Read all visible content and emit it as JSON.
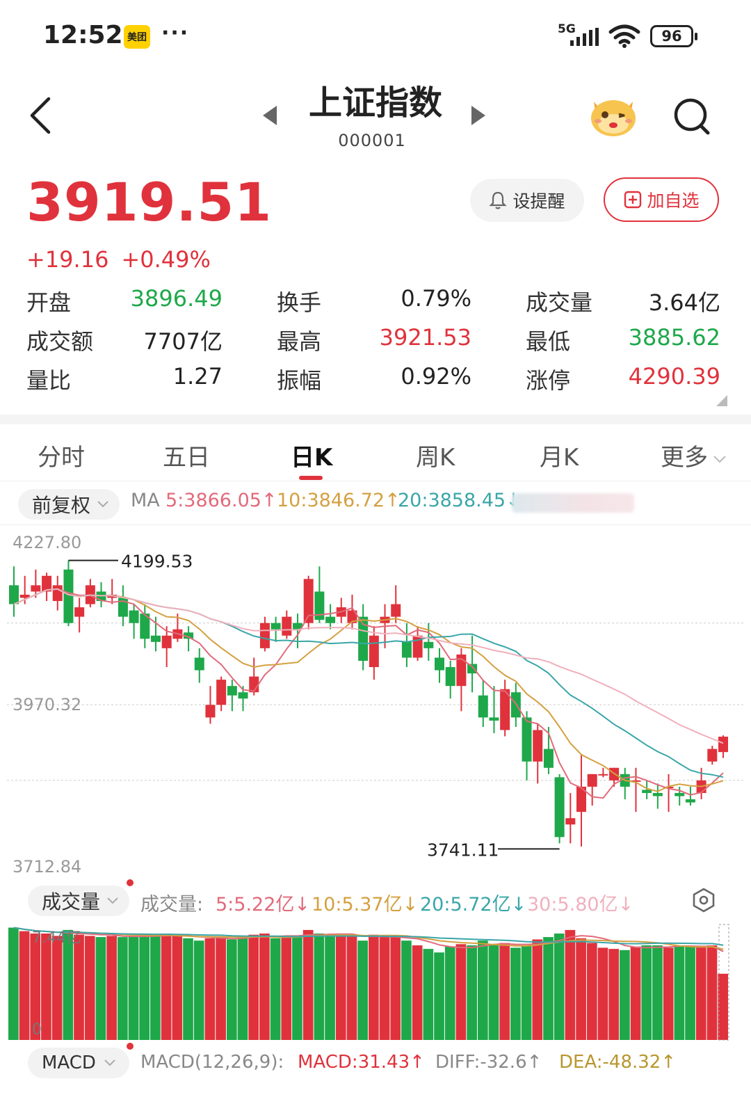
{
  "status": {
    "time": "12:52",
    "app_badge": "美团",
    "more": "···",
    "network": "5G",
    "battery": "96"
  },
  "header": {
    "title": "上证指数",
    "code": "000001"
  },
  "quote": {
    "price": "3919.51",
    "change": "+19.16",
    "change_pct": "+0.49%",
    "alert_label": "设提醒",
    "watch_label": "加自选",
    "stats": [
      {
        "label": "开盘",
        "value": "3896.49",
        "color": "green"
      },
      {
        "label": "换手",
        "value": "0.79%",
        "color": "dark"
      },
      {
        "label": "成交量",
        "value": "3.64亿",
        "color": "dark"
      },
      {
        "label": "成交额",
        "value": "7707亿",
        "color": "dark"
      },
      {
        "label": "最高",
        "value": "3921.53",
        "color": "red"
      },
      {
        "label": "最低",
        "value": "3885.62",
        "color": "green"
      },
      {
        "label": "量比",
        "value": "1.27",
        "color": "dark"
      },
      {
        "label": "振幅",
        "value": "0.92%",
        "color": "dark"
      },
      {
        "label": "涨停",
        "value": "4290.39",
        "color": "red"
      }
    ]
  },
  "tabs": [
    "分时",
    "五日",
    "日K",
    "周K",
    "月K",
    "更多"
  ],
  "ma_bar": {
    "adjust": "前复权",
    "ma_label": "MA",
    "ma5": "5:3866.05↑",
    "ma10": "10:3846.72↑",
    "ma20": "20:3858.45↓"
  },
  "volume_bar": {
    "label": "成交量",
    "title": "成交量:",
    "v5": "5:5.22亿↓",
    "v10": "10:5.37亿↓",
    "v20": "20:5.72亿↓",
    "v30": "30:5.80亿↓"
  },
  "macd_bar": {
    "label": "MACD",
    "params": "MACD(12,26,9):",
    "macd": "MACD:31.43↑",
    "diff": "DIFF:-32.6↑",
    "dea": "DEA:-48.32↑"
  },
  "colors": {
    "up": "#e0323c",
    "down": "#1ea84a",
    "ma5": "#e26a7a",
    "ma10": "#d4a040",
    "ma20": "#3aa6a8",
    "ma30": "#f0b0bc"
  },
  "chart_data": {
    "type": "candlestick",
    "y_axis_labels": [
      "4227.80",
      "3970.32",
      "3712.84"
    ],
    "ylim": [
      3712.84,
      4227.8
    ],
    "annotations": {
      "high": "4199.53",
      "low": "3741.11"
    },
    "candles": [
      [
        4160,
        4130,
        4190,
        4110
      ],
      [
        4140,
        4145,
        4175,
        4130
      ],
      [
        4150,
        4160,
        4185,
        4140
      ],
      [
        4150,
        4175,
        4180,
        4135
      ],
      [
        4135,
        4160,
        4175,
        4120
      ],
      [
        4185,
        4100,
        4199.53,
        4095
      ],
      [
        4110,
        4125,
        4140,
        4085
      ],
      [
        4130,
        4160,
        4170,
        4125
      ],
      [
        4150,
        4135,
        4165,
        4125
      ],
      [
        4140,
        4145,
        4170,
        4130
      ],
      [
        4140,
        4110,
        4160,
        4095
      ],
      [
        4120,
        4100,
        4130,
        4075
      ],
      [
        4115,
        4075,
        4130,
        4060
      ],
      [
        4080,
        4070,
        4110,
        4055
      ],
      [
        4060,
        4080,
        4095,
        4030
      ],
      [
        4075,
        4090,
        4115,
        4070
      ],
      [
        4085,
        4075,
        4095,
        4055
      ],
      [
        4045,
        4025,
        4060,
        4005
      ],
      [
        3950,
        3970,
        4000,
        3940
      ],
      [
        3970,
        4010,
        4015,
        3960
      ],
      [
        4000,
        3985,
        4010,
        3960
      ],
      [
        3990,
        3980,
        4000,
        3960
      ],
      [
        3990,
        4015,
        4045,
        3985
      ],
      [
        4060,
        4100,
        4110,
        4055
      ],
      [
        4100,
        4090,
        4110,
        4070
      ],
      [
        4080,
        4110,
        4120,
        4075
      ],
      [
        4100,
        4090,
        4115,
        4060
      ],
      [
        4100,
        4170,
        4175,
        4090
      ],
      [
        4150,
        4105,
        4190,
        4100
      ],
      [
        4110,
        4100,
        4130,
        4090
      ],
      [
        4110,
        4125,
        4140,
        4100
      ],
      [
        4100,
        4120,
        4145,
        4090
      ],
      [
        4110,
        4040,
        4130,
        4025
      ],
      [
        4030,
        4080,
        4095,
        4010
      ],
      [
        4100,
        4110,
        4130,
        4060
      ],
      [
        4110,
        4130,
        4160,
        4100
      ],
      [
        4070,
        4045,
        4100,
        4030
      ],
      [
        4045,
        4080,
        4095,
        4040
      ],
      [
        4070,
        4060,
        4100,
        4040
      ],
      [
        4045,
        4025,
        4060,
        4005
      ],
      [
        4030,
        4000,
        4040,
        3980
      ],
      [
        4000,
        4050,
        4060,
        3960
      ],
      [
        4035,
        4020,
        4080,
        3990
      ],
      [
        3985,
        3950,
        4010,
        3935
      ],
      [
        3950,
        3945,
        4000,
        3925
      ],
      [
        3930,
        3995,
        4010,
        3920
      ],
      [
        3990,
        3950,
        4005,
        3935
      ],
      [
        3950,
        3880,
        3960,
        3850
      ],
      [
        3880,
        3930,
        3940,
        3845
      ],
      [
        3900,
        3870,
        3935,
        3860
      ],
      [
        3855,
        3760,
        3860,
        3750
      ],
      [
        3780,
        3790,
        3830,
        3750
      ],
      [
        3800,
        3840,
        3890,
        3745
      ],
      [
        3840,
        3860,
        3860,
        3810
      ],
      [
        3860,
        3860,
        3870,
        3855
      ],
      [
        3850,
        3870,
        3870,
        3840
      ],
      [
        3860,
        3840,
        3870,
        3820
      ],
      [
        3850,
        3850,
        3870,
        3800
      ],
      [
        3835,
        3830,
        3850,
        3820
      ],
      [
        3830,
        3825,
        3845,
        3805
      ],
      [
        3840,
        3840,
        3860,
        3800
      ],
      [
        3830,
        3825,
        3840,
        3810
      ],
      [
        3820,
        3815,
        3840,
        3810
      ],
      [
        3830,
        3850,
        3870,
        3820
      ],
      [
        3880,
        3900,
        3905,
        3875
      ],
      [
        3895,
        3919.51,
        3921.53,
        3885.62
      ]
    ],
    "volumes_relative": [
      0.95,
      0.92,
      0.9,
      0.9,
      0.88,
      0.93,
      0.89,
      0.88,
      0.87,
      0.88,
      0.87,
      0.88,
      0.88,
      0.88,
      0.9,
      0.88,
      0.86,
      0.84,
      0.86,
      0.87,
      0.85,
      0.88,
      0.89,
      0.9,
      0.86,
      0.87,
      0.88,
      0.93,
      0.9,
      0.89,
      0.88,
      0.88,
      0.84,
      0.89,
      0.88,
      0.87,
      0.84,
      0.8,
      0.77,
      0.74,
      0.79,
      0.81,
      0.8,
      0.84,
      0.8,
      0.82,
      0.78,
      0.8,
      0.85,
      0.87,
      0.9,
      0.93,
      0.86,
      0.82,
      0.78,
      0.77,
      0.76,
      0.79,
      0.8,
      0.8,
      0.78,
      0.8,
      0.79,
      0.79,
      0.8,
      0.56
    ],
    "volume_axis_labels": [
      "7.44亿",
      "0"
    ]
  }
}
